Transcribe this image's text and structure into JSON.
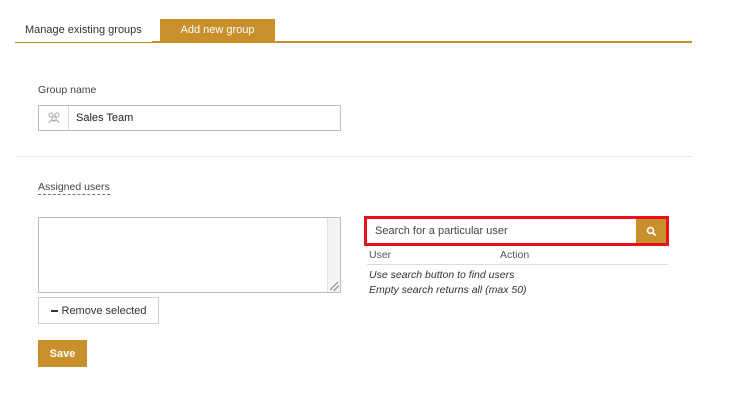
{
  "tabs": [
    {
      "label": "Manage existing groups",
      "active": false
    },
    {
      "label": "Add new group",
      "active": true
    }
  ],
  "form": {
    "group_name_label": "Group name",
    "group_name_value": "Sales Team",
    "group_icon": "users-icon",
    "assigned_users_label": "Assigned users",
    "remove_selected_label": "Remove selected",
    "save_label": "Save"
  },
  "search": {
    "placeholder": "Search for a particular user",
    "button_icon": "search-icon",
    "columns": [
      "User",
      "Action"
    ],
    "hint_line1": "Use search button to find users",
    "hint_line2": "Empty search returns all (max 50)"
  },
  "colors": {
    "accent": "#c98f2b",
    "highlight": "#e8121d"
  }
}
